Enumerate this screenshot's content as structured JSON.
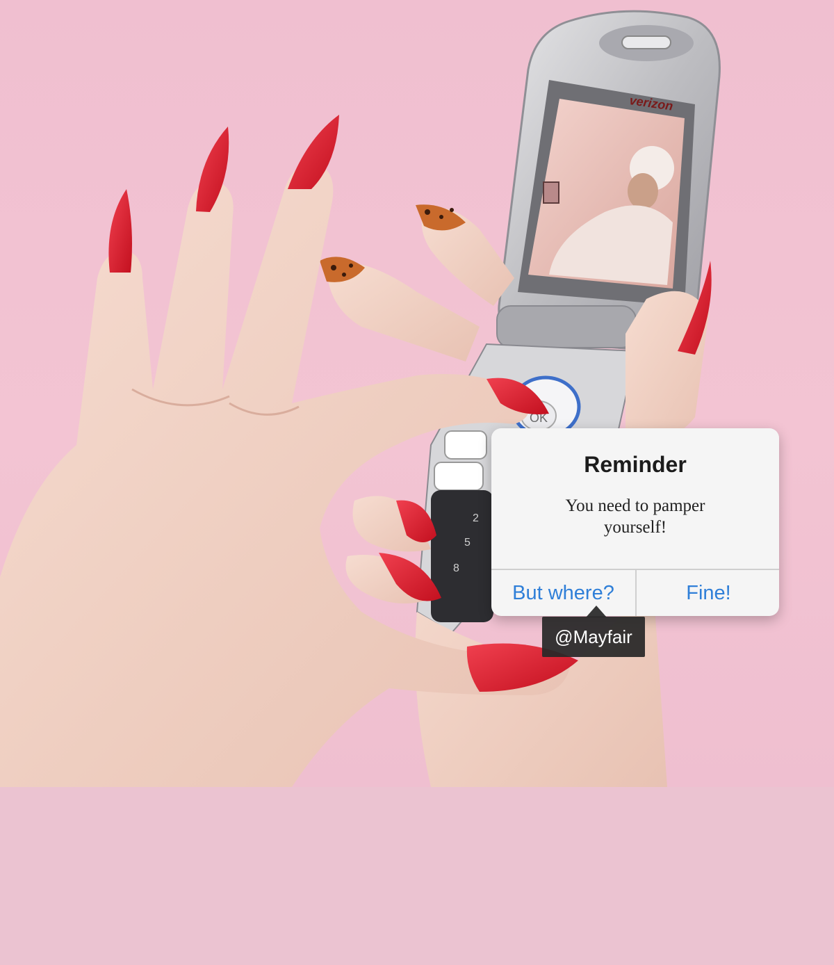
{
  "photo": {
    "phone_brand": "verizon",
    "ok_key": "OK",
    "keypad_digits": [
      "2",
      "5",
      "8"
    ]
  },
  "dialog": {
    "title": "Reminder",
    "message": "You need to pamper yourself!",
    "buttons": {
      "left": "But where?",
      "right": "Fine!"
    },
    "button_color": "#2f7fd8"
  },
  "tooltip": {
    "text": "@Mayfair"
  },
  "colors": {
    "background_pink": "#f0bfd0",
    "nail_red": "#d8162a",
    "phone_silver": "#c9c9cb"
  }
}
